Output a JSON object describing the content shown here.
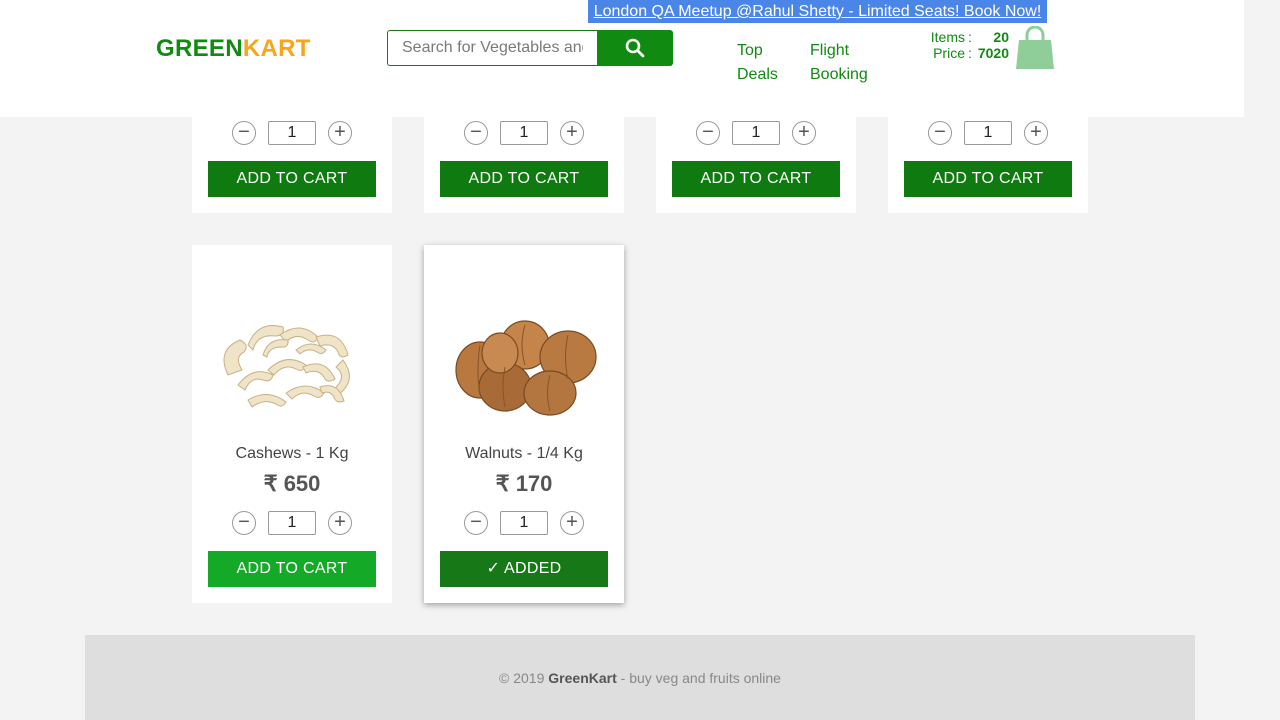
{
  "header": {
    "brand_part1": "GREEN",
    "brand_part2": "KART",
    "banner": "London QA Meetup @Rahul Shetty - Limited Seats! Book Now!",
    "search_placeholder": "Search for Vegetables and Fruits",
    "search_icon": "search-icon",
    "nav": {
      "top_line1": "Top",
      "top_line2": "Deals",
      "flight_line1": "Flight",
      "flight_line2": "Booking"
    },
    "cart": {
      "items_label": "Items",
      "items_sep": ":",
      "items_value": "20",
      "price_label": "Price",
      "price_sep": ":",
      "price_value": "7020",
      "bag_icon": "shopping-bag-icon"
    }
  },
  "qty_minus": "−",
  "qty_plus": "+",
  "top_row": [
    {
      "quantity": "1",
      "button": "ADD TO CART"
    },
    {
      "quantity": "1",
      "button": "ADD TO CART"
    },
    {
      "quantity": "1",
      "button": "ADD TO CART"
    },
    {
      "quantity": "1",
      "button": "ADD TO CART"
    }
  ],
  "products": [
    {
      "name": "Cashews - 1 Kg",
      "price": "₹ 650",
      "quantity": "1",
      "button": "ADD TO CART",
      "image_icon": "cashews-image"
    },
    {
      "name": "Walnuts - 1/4 Kg",
      "price": "₹ 170",
      "quantity": "1",
      "button": "✓ ADDED",
      "image_icon": "walnuts-image"
    }
  ],
  "footer": {
    "copyright": "© 2019",
    "brand": "GreenKart",
    "tagline": "- buy veg and fruits online"
  },
  "colors": {
    "brand_green": "#118a11",
    "brand_orange": "#f9a51a",
    "banner_blue": "#4a86e8"
  }
}
